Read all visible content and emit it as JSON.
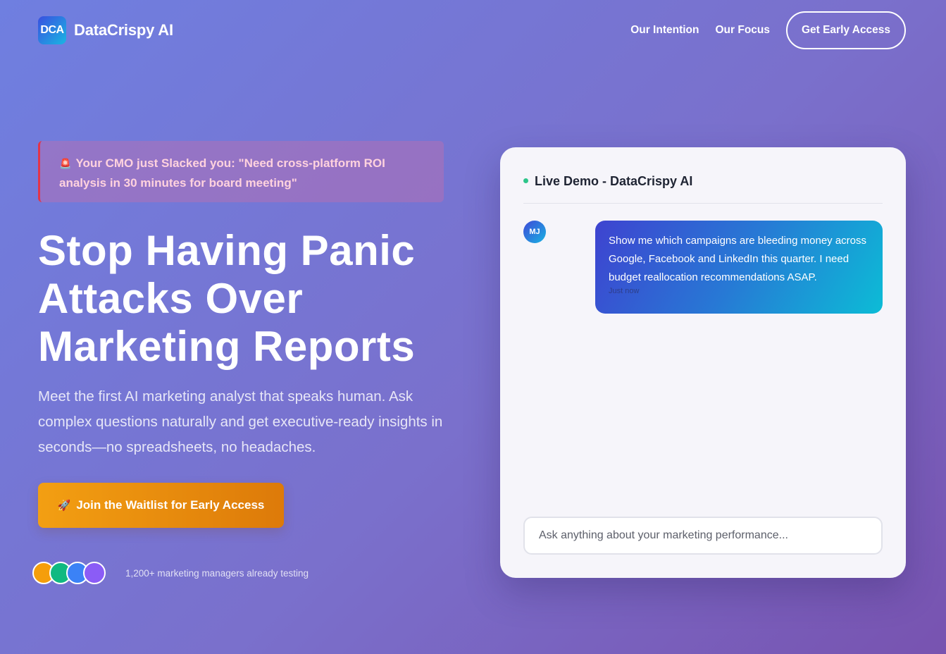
{
  "brand": {
    "logo_text": "DCA",
    "name": "DataCrispy AI"
  },
  "nav": {
    "links": [
      "Our Intention",
      "Our Focus"
    ],
    "cta_label": "Get Early Access"
  },
  "alert": {
    "icon": "🚨",
    "text": "Your CMO just Slacked you: \"Need cross-platform ROI analysis in 30 minutes for board meeting\""
  },
  "hero": {
    "headline": "Stop Having Panic Attacks Over Marketing Reports",
    "subtext": "Meet the first AI marketing analyst that speaks human. Ask complex questions naturally and get executive-ready insights in seconds—no spreadsheets, no headaches.",
    "button_icon": "🚀",
    "button_label": "Join the Waitlist for Early Access"
  },
  "social_proof": {
    "avatar_colors": [
      "#f59e0b",
      "#10b981",
      "#3b82f6",
      "#8b5cf6"
    ],
    "text": "1,200+ marketing managers already testing"
  },
  "demo": {
    "title": "Live Demo - DataCrispy AI",
    "status_color": "#2dc58a",
    "message": {
      "avatar": "MJ",
      "text": "Show me which campaigns are bleeding money across Google, Facebook and LinkedIn this quarter. I need budget reallocation recommendations ASAP.",
      "time": "Just now"
    },
    "input_placeholder": "Ask anything about your marketing performance..."
  }
}
